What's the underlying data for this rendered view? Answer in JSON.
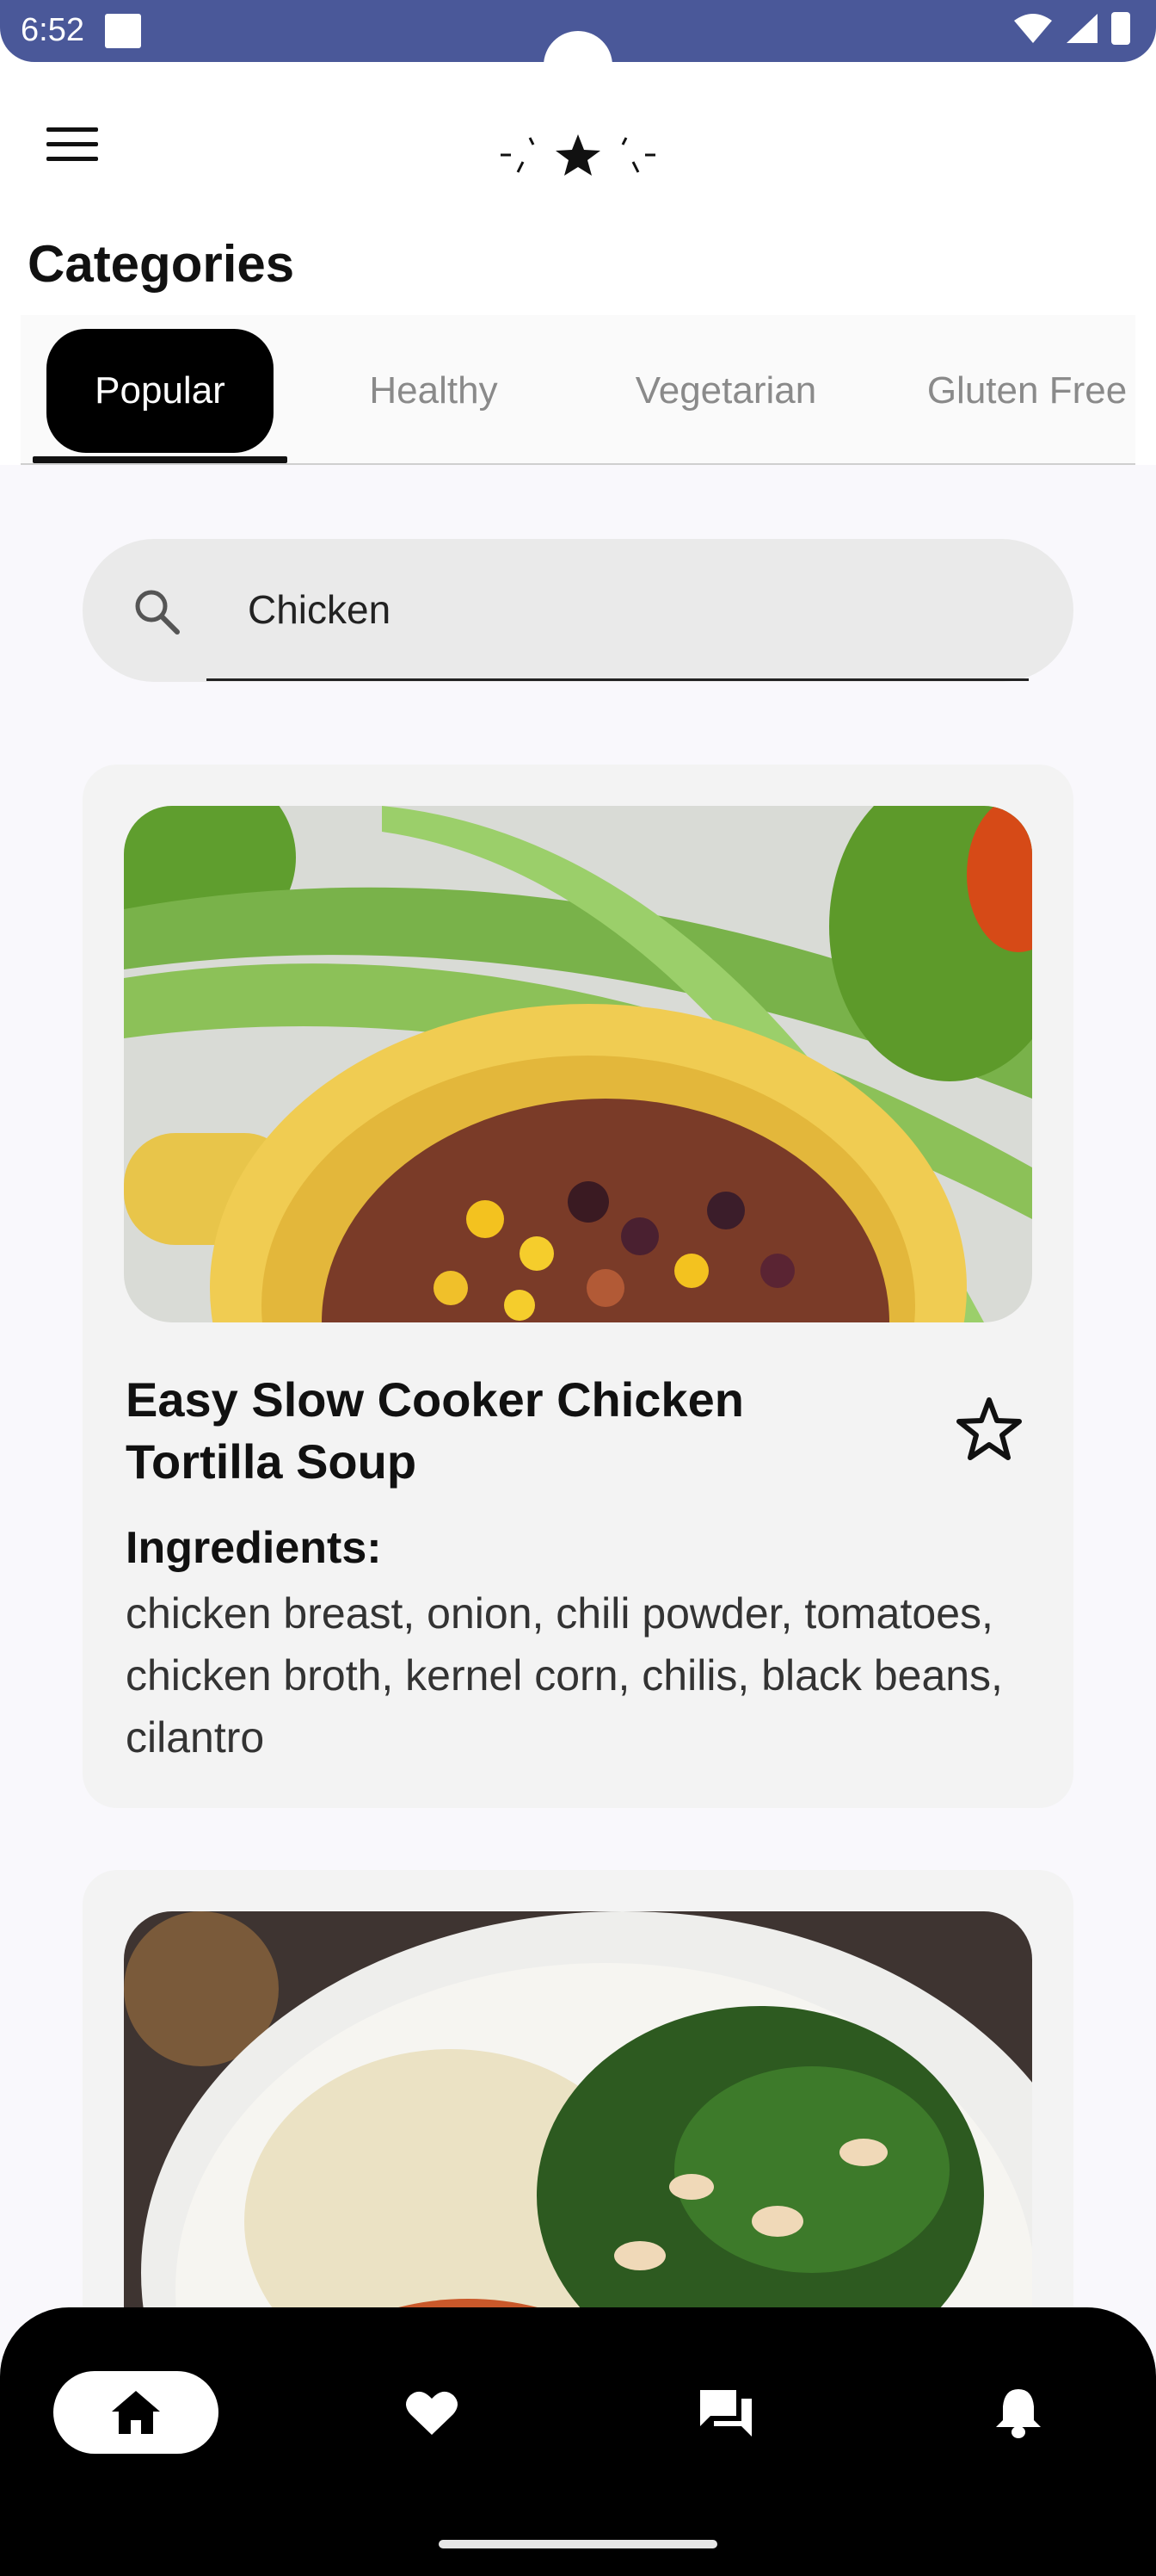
{
  "status_bar": {
    "time": "6:52"
  },
  "header": {
    "title": "Categories"
  },
  "tabs": [
    {
      "label": "Popular",
      "active": true
    },
    {
      "label": "Healthy",
      "active": false
    },
    {
      "label": "Vegetarian",
      "active": false
    },
    {
      "label": "Gluten Free",
      "active": false
    }
  ],
  "search": {
    "value": "Chicken",
    "placeholder": ""
  },
  "recipes": [
    {
      "title": "Easy Slow Cooker Chicken Tortilla Soup",
      "ingredients_label": "Ingredients:",
      "ingredients": "chicken breast, onion, chili powder, tomatoes, chicken broth, kernel corn, chilis, black beans, cilantro"
    },
    {
      "title": "",
      "ingredients_label": "",
      "ingredients": ""
    }
  ],
  "bottom_nav": [
    {
      "icon": "home-icon",
      "active": true
    },
    {
      "icon": "heart-icon",
      "active": false
    },
    {
      "icon": "chat-icon",
      "active": false
    },
    {
      "icon": "bell-icon",
      "active": false
    }
  ],
  "colors": {
    "status_bar": "#4a5899",
    "tab_active_bg": "#000000",
    "tab_inactive_text": "#8a8a8a",
    "card_bg": "#f3f3f3",
    "nav_bg": "#000000"
  }
}
